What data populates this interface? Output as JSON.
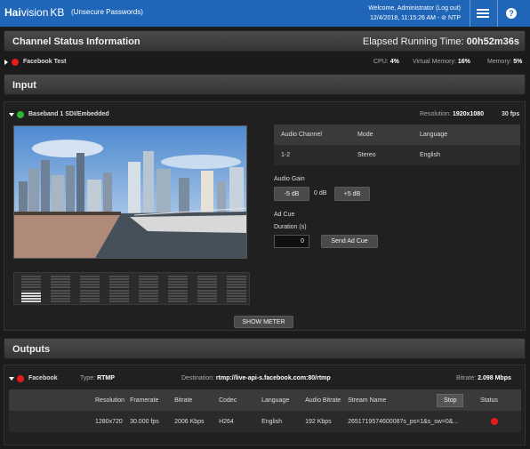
{
  "topbar": {
    "brand_hai": "Hai",
    "brand_vision": "vision",
    "brand_kb": "KB",
    "unsecure": "(Unsecure Passwords)",
    "welcome": "Welcome, Administrator   (Log out)",
    "datetime": "12/4/2018, 11:15:26 AM - ⊘ NTP"
  },
  "channel_status": {
    "title": "Channel Status Information",
    "elapsed_label": "Elapsed Running Time:",
    "elapsed_value": "00h52m36s",
    "channel_name": "Facebook Test",
    "cpu_label": "CPU:",
    "cpu_value": "4%",
    "vmem_label": "Virtual Memory:",
    "vmem_value": "16%",
    "mem_label": "Memory:",
    "mem_value": "5%"
  },
  "input": {
    "title": "Input",
    "source_name": "Baseband 1 SDI/Embedded",
    "resolution_label": "Resolution:",
    "resolution_value": "1920x1080",
    "fps": "30 fps",
    "audio_table": {
      "headers": [
        "Audio Channel",
        "Mode",
        "Language"
      ],
      "row": [
        "1-2",
        "Stereo",
        "English"
      ]
    },
    "audio_gain_label": "Audio Gain",
    "gain_minus": "-5 dB",
    "gain_value": "0 dB",
    "gain_plus": "+5 dB",
    "ad_cue_label": "Ad Cue",
    "duration_label": "Duration (s)",
    "duration_value": "0",
    "send_ad_cue": "Send Ad Cue",
    "show_meter": "SHOW METER",
    "meter_active_index": 0,
    "meter_count": 8
  },
  "outputs": {
    "title": "Outputs",
    "name": "Facebook",
    "type_label": "Type:",
    "type_value": "RTMP",
    "dest_label": "Destination:",
    "dest_value": "rtmp://live-api-s.facebook.com:80/rtmp",
    "bitrate_label": "Bitrate:",
    "bitrate_value": "2.098 Mbps",
    "table_headers": [
      "Resolution",
      "Framerate",
      "Bitrate",
      "Codec",
      "Language",
      "Audio Bitrate",
      "Stream Name",
      "Stop",
      "Status"
    ],
    "row": [
      "1280x720",
      "30.000 fps",
      "2006 Kbps",
      "H264",
      "English",
      "192 Kbps",
      "2651719574600087s_ps=1&s_sw=0&..."
    ],
    "status_color": "#e51b1b"
  },
  "colors": {
    "accent": "#1f66b8",
    "status_red": "#e51b1b",
    "status_green": "#2fb62f"
  }
}
